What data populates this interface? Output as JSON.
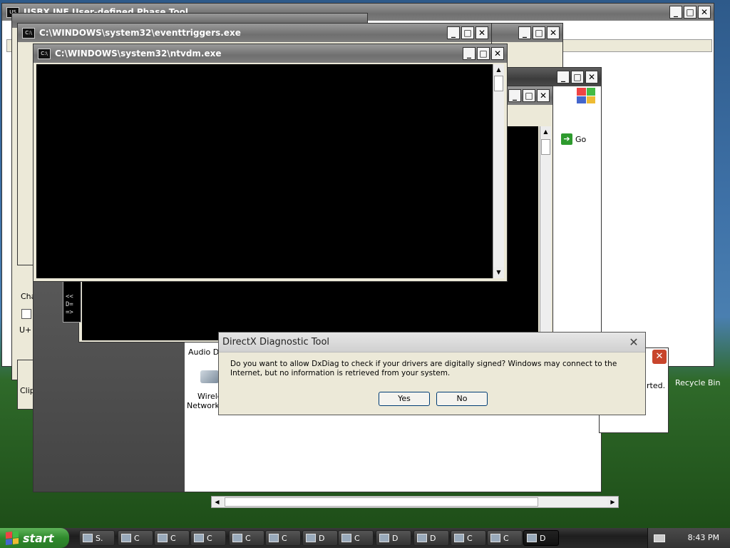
{
  "windows": {
    "usbx": {
      "title": "USBX INF User-defined Phase Tool"
    },
    "eventtriggers": {
      "title": "C:\\WINDOWS\\system32\\eventtriggers.exe"
    },
    "ntvdm": {
      "title": "C:\\WINDOWS\\system32\\ntvdm.exe"
    },
    "explorer": {
      "go_label": "Go",
      "items": [
        "Audio De",
        "Wirele",
        "Network"
      ],
      "partial_ch": "Cha",
      "partial_u": "U+",
      "partial_clip": "Clip"
    },
    "notice": {
      "partial_text": "rted."
    }
  },
  "dialog": {
    "title": "DirectX Diagnostic Tool",
    "message": "Do you want to allow DxDiag to check if your drivers are digitally signed? Windows may connect to the Internet, but no information is retrieved from your system.",
    "yes_label": "Yes",
    "no_label": "No"
  },
  "desktop": {
    "recycle_bin_label": "Recycle Bin"
  },
  "taskbar": {
    "start_label": "start",
    "buttons": [
      {
        "label": "S."
      },
      {
        "label": "C"
      },
      {
        "label": "C"
      },
      {
        "label": "C"
      },
      {
        "label": "C"
      },
      {
        "label": "C"
      },
      {
        "label": "D"
      },
      {
        "label": "C"
      },
      {
        "label": "D"
      },
      {
        "label": "D"
      },
      {
        "label": "C"
      },
      {
        "label": "C"
      },
      {
        "label": "D"
      }
    ],
    "clock": "8:43 PM"
  },
  "colors": {
    "start_green": "#2f8a2c",
    "dialog_bg": "#ece9d8",
    "console_bg": "#000000"
  }
}
